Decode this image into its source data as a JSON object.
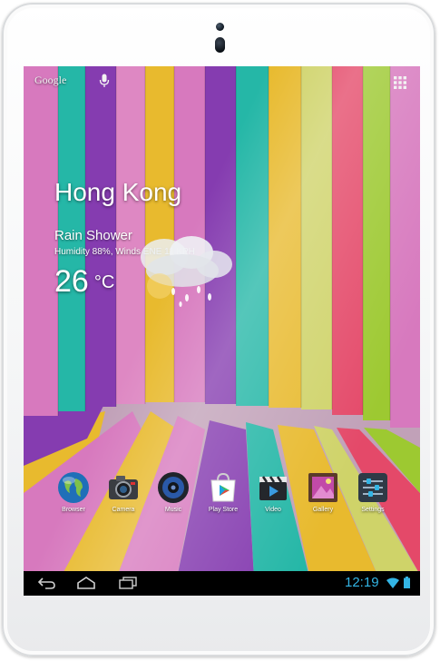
{
  "device": {
    "type": "tablet",
    "color": "#ffffff"
  },
  "top_bar": {
    "search_brand": "Google",
    "mic_icon": "microphone-icon",
    "apps_icon": "all-apps-grid-icon"
  },
  "weather": {
    "city": "Hong Kong",
    "condition": "Rain Shower",
    "details": "Humidity 88%, Winds ENE 11 KPH",
    "temperature": "26",
    "unit": "°C",
    "icon": "rain-cloud-icon"
  },
  "dock": {
    "apps": [
      {
        "label": "Browser",
        "icon": "globe-icon"
      },
      {
        "label": "Camera",
        "icon": "camera-icon"
      },
      {
        "label": "Music",
        "icon": "speaker-icon"
      },
      {
        "label": "Play Store",
        "icon": "play-store-icon"
      },
      {
        "label": "Video",
        "icon": "clapperboard-icon"
      },
      {
        "label": "Gallery",
        "icon": "gallery-icon"
      },
      {
        "label": "Settings",
        "icon": "settings-sliders-icon"
      }
    ]
  },
  "nav_bar": {
    "back_icon": "back-icon",
    "home_icon": "home-icon",
    "recents_icon": "recent-apps-icon",
    "time": "12:19",
    "wifi_icon": "wifi-icon",
    "battery_icon": "battery-icon",
    "accent_color": "#33b5e5"
  },
  "wallpaper": {
    "colors": [
      "#e07ec6",
      "#27bfae",
      "#8b3fb8",
      "#f2c230",
      "#a4d234",
      "#ee4d6e"
    ]
  }
}
